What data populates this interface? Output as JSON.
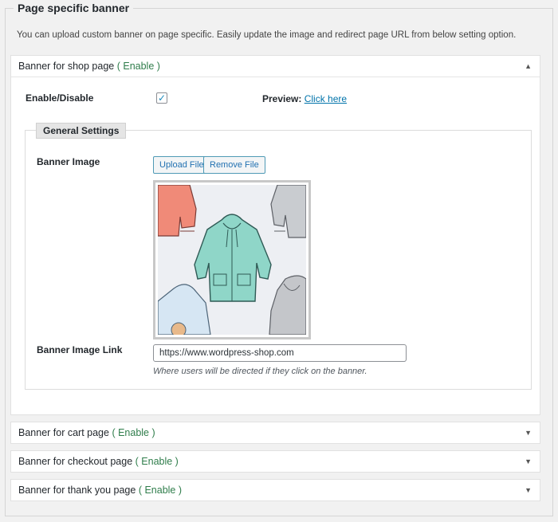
{
  "section": {
    "title": "Page specific banner",
    "description": "You can upload custom banner on page specific. Easily update the image and redirect page URL from below setting option."
  },
  "panels": {
    "shop": {
      "label": "Banner for shop page",
      "status": "( Enable )",
      "arrow": "▲",
      "enable_label": "Enable/Disable",
      "enabled_check": "✓",
      "preview_label": "Preview:",
      "preview_link": "Click here",
      "general_settings_title": "General Settings",
      "banner_image_label": "Banner Image",
      "upload_button": "Upload File",
      "remove_button": "Remove File",
      "image_icon": "hoodies-pattern-image",
      "banner_link_label": "Banner Image Link",
      "banner_link_value": "https://www.wordpress-shop.com",
      "banner_link_hint": "Where users will be directed if they click on the banner."
    },
    "cart": {
      "label": "Banner for cart page",
      "status": "( Enable )",
      "arrow": "▼"
    },
    "checkout": {
      "label": "Banner for checkout page",
      "status": "( Enable )",
      "arrow": "▼"
    },
    "thanks": {
      "label": "Banner for thank you page",
      "status": "( Enable )",
      "arrow": "▼"
    }
  },
  "colors": {
    "status_green": "#2f7d4b",
    "link_blue": "#0073aa",
    "background": "#f1f1f1"
  }
}
